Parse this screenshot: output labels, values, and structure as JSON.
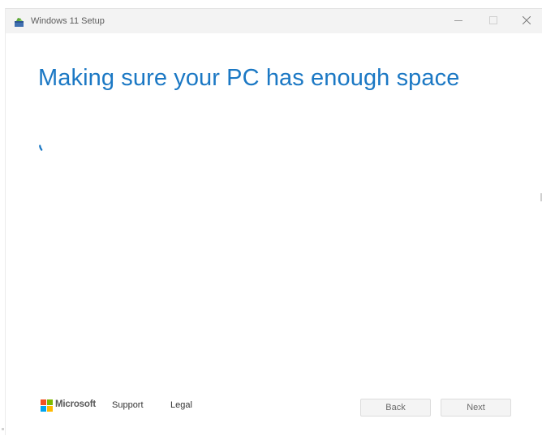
{
  "window": {
    "title": "Windows 11 Setup",
    "app_icon": "setup-box-icon",
    "controls": {
      "minimize": "minimize-icon",
      "maximize": "maximize-icon",
      "close": "close-icon"
    }
  },
  "main": {
    "heading": "Making sure your PC has enough space",
    "spinner": "loading-spinner-icon"
  },
  "footer": {
    "brand": "Microsoft",
    "links": [
      "Support",
      "Legal"
    ],
    "buttons": {
      "back": "Back",
      "next": "Next"
    }
  },
  "colors": {
    "accent": "#1b78c4",
    "titlebar": "#f3f3f3",
    "button_bg": "#f4f4f4",
    "logo_red": "#f25022",
    "logo_green": "#7fba00",
    "logo_blue": "#00a4ef",
    "logo_yellow": "#ffb900"
  }
}
